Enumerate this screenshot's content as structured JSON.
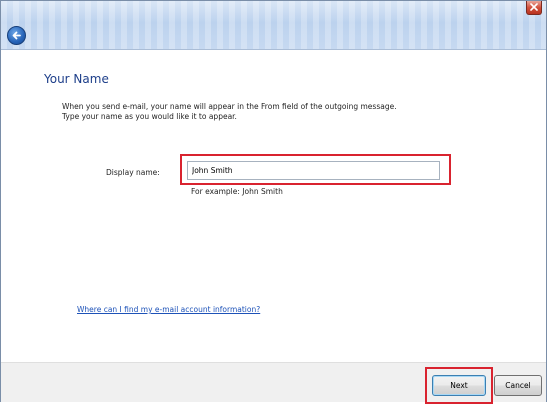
{
  "wizard": {
    "page_title": "Your Name",
    "description_line1": "When you send e-mail, your name will appear in the From field of the outgoing message.",
    "description_line2": "Type your name as you would like it to appear.",
    "display_name_label": "Display name:",
    "display_name_value": "John Smith",
    "example_text": "For example: John Smith",
    "help_link": "Where can I find my e-mail account information?"
  },
  "buttons": {
    "next": "Next",
    "cancel": "Cancel"
  },
  "icons": {
    "back": "back-arrow-icon",
    "close": "close-icon"
  },
  "colors": {
    "title": "#1e3f8a",
    "link": "#1d52b8",
    "highlight": "#d9232f"
  }
}
